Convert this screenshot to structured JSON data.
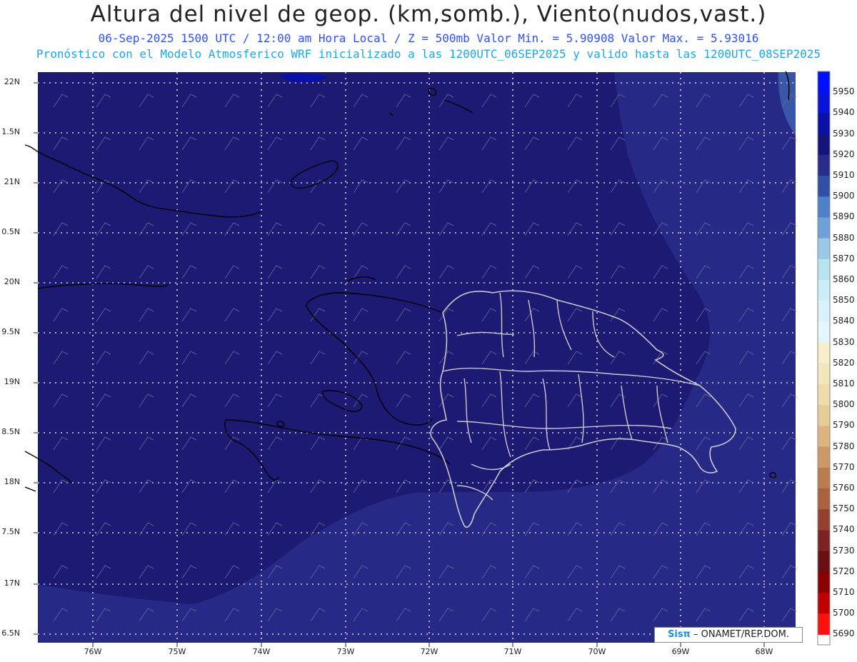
{
  "header": {
    "title": "Altura del nivel de geop. (km,somb.), Viento(nudos,vast.)",
    "subtitle1": "06-Sep-2025  1500 UTC / 12:00 am Hora Local / Z = 500mb   Valor Min. = 5.90908  Valor Max. = 5.93016",
    "subtitle2": "Pronóstico con el Modelo Atmosferico WRF inicializado a las 1200UTC_06SEP2025 y valido hasta las  1200UTC_08SEP2025"
  },
  "axes": {
    "lat_labels": [
      "22N",
      "1.5N",
      "21N",
      "0.5N",
      "20N",
      "9.5N",
      "19N",
      "8.5N",
      "18N",
      "7.5N",
      "17N",
      "6.5N"
    ],
    "lon_labels": [
      "76W",
      "75W",
      "74W",
      "73W",
      "72W",
      "71W",
      "70W",
      "69W",
      "68W"
    ]
  },
  "colorbar": {
    "levels": [
      "5950",
      "5940",
      "5930",
      "5920",
      "5910",
      "5900",
      "5890",
      "5880",
      "5870",
      "5860",
      "5850",
      "5840",
      "5830",
      "5820",
      "5810",
      "5800",
      "5790",
      "5780",
      "5770",
      "5760",
      "5750",
      "5740",
      "5730",
      "5720",
      "5710",
      "5700",
      "5690"
    ],
    "colors": [
      "#0010ff",
      "#0a14d8",
      "#0a10a8",
      "#14147a",
      "#2a2c8a",
      "#3050a8",
      "#4f7fc8",
      "#6fa0d8",
      "#9cc8e8",
      "#b8e4f2",
      "#cdeef8",
      "#d9f2fb",
      "#e4f6fc",
      "#f7eecb",
      "#f3e6bd",
      "#eedcaa",
      "#e6cc95",
      "#dbb47f",
      "#cc9866",
      "#b97d4d",
      "#a9623d",
      "#93402e",
      "#7d2323",
      "#6a0f14",
      "#8a0000",
      "#c00000",
      "#ff1010"
    ]
  },
  "map": {
    "background": "#1c1a72",
    "southern_band": "#262a86",
    "eastern_band": "#232680",
    "grid_color": "#d8d8d8",
    "barb_color": "#6a6aa0"
  },
  "credit": {
    "brand": "Sisπ",
    "text": " – ONAMET/REP.DOM."
  }
}
